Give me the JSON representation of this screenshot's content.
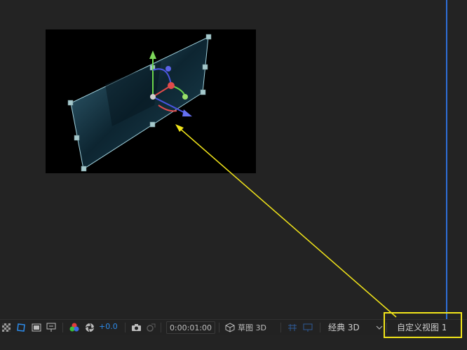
{
  "toolbar": {
    "exposure_value": "+0.0",
    "timecode": "0:00:01:00",
    "renderer_label": "草图 3D",
    "renderer_selected": "经典 3D",
    "view_selected": "自定义视图 1"
  },
  "icons": [
    "checkerboard-icon",
    "mask-icon",
    "region-icon",
    "guides-icon",
    "color-channels-icon",
    "reset-exposure-icon",
    "camera-icon",
    "snapshot-icon",
    "draft3d-icon",
    "extended-viewer-icon",
    "chevron-down-icon"
  ],
  "colors": {
    "accent": "#2f6fd8",
    "highlight": "#f2e51a",
    "gizmo_x": "#e14b4b",
    "gizmo_y": "#7dd75a",
    "gizmo_z": "#4b55e1"
  }
}
